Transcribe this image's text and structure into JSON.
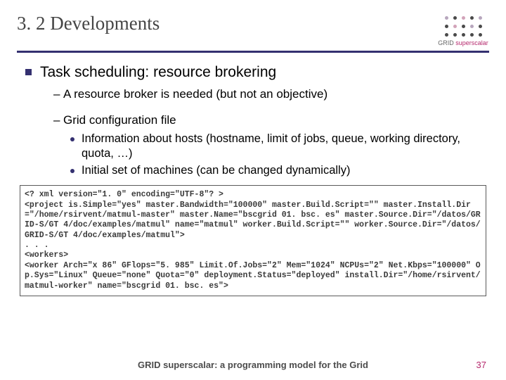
{
  "header": {
    "title": "3. 2 Developments",
    "logo_text_1": "GRID",
    "logo_text_2": "superscalar"
  },
  "body": {
    "main_bullet": "Task scheduling: resource brokering",
    "sub1": "A resource broker is needed (but not an objective)",
    "sub2": "Grid configuration file",
    "sub2_items": [
      "Information about hosts (hostname, limit of jobs, queue, working directory, quota, …)",
      "Initial set of machines (can be changed dynamically)"
    ]
  },
  "code": "<? xml version=\"1. 0\" encoding=\"UTF-8\"? >\n<project is.Simple=\"yes\" master.Bandwidth=\"100000\" master.Build.Script=\"\" master.Install.Dir=\"/home/rsirvent/matmul-master\" master.Name=\"bscgrid 01. bsc. es\" master.Source.Dir=\"/datos/GRID-S/GT 4/doc/examples/matmul\" name=\"matmul\" worker.Build.Script=\"\" worker.Source.Dir=\"/datos/GRID-S/GT 4/doc/examples/matmul\">\n. . .\n<workers>\n<worker Arch=\"x 86\" GFlops=\"5. 985\" Limit.Of.Jobs=\"2\" Mem=\"1024\" NCPUs=\"2\" Net.Kbps=\"100000\" Op.Sys=\"Linux\" Queue=\"none\" Quota=\"0\" deployment.Status=\"deployed\" install.Dir=\"/home/rsirvent/matmul-worker\" name=\"bscgrid 01. bsc. es\">",
  "footer": {
    "text": "GRID superscalar: a programming model for the Grid",
    "page": "37"
  }
}
